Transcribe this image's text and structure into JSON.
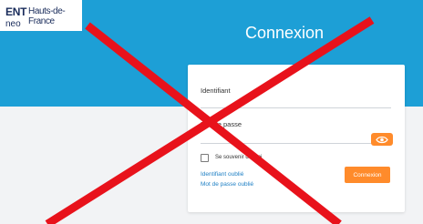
{
  "header": {
    "logo_ent": "ENT",
    "logo_region": "Hauts-de-France",
    "logo_neo": "neo",
    "title": "Connexion"
  },
  "form": {
    "identifier_label": "Identifiant",
    "password_label": "Mot de passe",
    "remember_label": "Se souvenir de moi",
    "forgot_identifier": "Identifiant oublié",
    "forgot_password": "Mot de passe oublié",
    "submit_label": "Connexion"
  },
  "icons": {
    "show_password": "eye-icon",
    "overlay": "red-cross-overlay"
  },
  "colors": {
    "header_blue": "#1d9fd6",
    "accent_orange": "#ff8b2b",
    "link_blue": "#1d7fc4",
    "cross_red": "#e8121b",
    "logo_navy": "#1a2c5b"
  }
}
